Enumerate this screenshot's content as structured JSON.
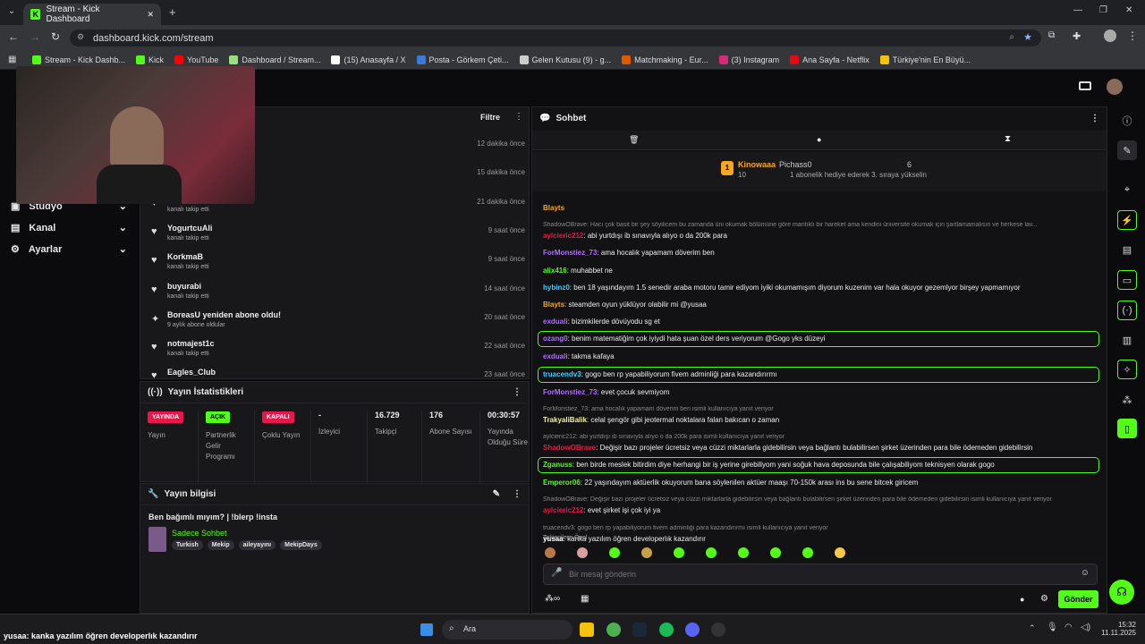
{
  "browser": {
    "tab_title": "Stream - Kick Dashboard",
    "url": "dashboard.kick.com/stream",
    "bookmarks": [
      {
        "label": "Stream - Kick Dashb...",
        "color": "#53fc18"
      },
      {
        "label": "Kick",
        "color": "#53fc18"
      },
      {
        "label": "YouTube",
        "color": "#ff0000"
      },
      {
        "label": "Dashboard / Stream...",
        "color": "#9adf7f"
      },
      {
        "label": "(15) Anasayfa / X",
        "color": "#ffffff"
      },
      {
        "label": "Posta - Görkem Çeti...",
        "color": "#3a7bd5"
      },
      {
        "label": "Gelen Kutusu (9) - g...",
        "color": "#cccccc"
      },
      {
        "label": "Matchmaking - Eur...",
        "color": "#e05a00"
      },
      {
        "label": "(3) Instagram",
        "color": "#d62976"
      },
      {
        "label": "Ana Sayfa - Netflix",
        "color": "#e50914"
      },
      {
        "label": "Türkiye'nin En Büyü...",
        "color": "#f4c20d"
      }
    ]
  },
  "sidebar": {
    "items": [
      {
        "label": "Stüdyo"
      },
      {
        "label": "Kanal"
      },
      {
        "label": "Ayarlar"
      }
    ]
  },
  "activity": {
    "filter_label": "Filtre",
    "items": [
      {
        "name": "",
        "sub": "",
        "time": "12 dakika önce"
      },
      {
        "name": "",
        "sub": "",
        "time": "15 dakika önce"
      },
      {
        "name": "",
        "sub": "kanalı takip etti",
        "time": "21 dakika önce"
      },
      {
        "name": "YogurtcuAli",
        "sub": "kanalı takip etti",
        "time": "9 saat önce"
      },
      {
        "name": "KorkmaB",
        "sub": "kanalı takip etti",
        "time": "9 saat önce"
      },
      {
        "name": "buyurabi",
        "sub": "kanalı takip etti",
        "time": "14 saat önce"
      },
      {
        "name": "BoreasU yeniden abone oldu!",
        "sub": "9 aylık abone oldular",
        "time": "20 saat önce"
      },
      {
        "name": "notmajest1c",
        "sub": "kanalı takip etti",
        "time": "22 saat önce"
      },
      {
        "name": "Eagles_Club",
        "sub": "",
        "time": "23 saat önce"
      }
    ]
  },
  "stats": {
    "title": "Yayın İstatistikleri",
    "items": [
      {
        "badge": "YAYINDA",
        "label": "Yayın",
        "badge_color": "#e6174b"
      },
      {
        "badge": "AÇIK",
        "label": "Partnerlik Gelir Programı",
        "badge_color": "#53fc18"
      },
      {
        "badge": "KAPALI",
        "label": "Çoklu Yayın",
        "badge_color": "#e6174b"
      },
      {
        "value": "-",
        "label": "İzleyici"
      },
      {
        "value": "16.729",
        "label": "Takipçi"
      },
      {
        "value": "176",
        "label": "Abone Sayısı"
      },
      {
        "value": "00:30:57",
        "label": "Yayında Olduğu Süre"
      }
    ]
  },
  "info": {
    "title": "Yayın bilgisi",
    "stream_title": "Ben bağımlı mıyım? | !blerp !insta",
    "category": "Sadece Sohbet",
    "tags": [
      "Turkish",
      "Mekip",
      "aileyayını",
      "MekipDays"
    ]
  },
  "chat": {
    "title": "Sohbet",
    "leader1": {
      "name": "Kinowaaa",
      "value": "10"
    },
    "leader2": {
      "name": "Pichass0",
      "value": "6",
      "sub": "1 abonelik hediye ederek 3. sıraya yükselin"
    },
    "messages": [
      {
        "user": "Blayts",
        "text": "",
        "color": "#f5a623",
        "hl": false
      },
      {
        "reply": "ShadowOBrave: Hacı çok basit bir şey söyilicem bu zamanda üni okumak bölümüne göre mantıklı bir hareket ama kendini üniversite okumak için şartlamamalısın ve herkese lav..."
      },
      {
        "user": "aylcieric212",
        "text": ": abi yurtdışı ib sınavıyla alıyo o da 200k para",
        "color": "#e6174b"
      },
      {
        "user": "ForMonstiez_73",
        "text": ": ama hocalık yapamam döverim ben",
        "color": "#b16cff"
      },
      {
        "user": "alix416",
        "text": ": muhabbet ne",
        "color": "#53fc18"
      },
      {
        "user": "hybinz0",
        "text": ": ben 18 yaşındayım 1.5 senedir araba motoru tamir ediyom iyiki okumamışım diyorum kuzenim var hala okuyor gezemlyor birşey yapmamıyor",
        "color": "#3ad1ff"
      },
      {
        "user": "Blayts",
        "text": ": steamden oyun yüklüyor olabilir mi @yusaa",
        "color": "#f5a623"
      },
      {
        "user": "exduali",
        "text": ": bizimkilerde dövüyodu sg et",
        "color": "#b16cff"
      },
      {
        "user": "ozang0",
        "text": ": benim matematiğim çok iyiydi hata şuan özel ders veriyorum @Gogo yks düzeyi",
        "color": "#b16cff",
        "hl": true
      },
      {
        "user": "exduali",
        "text": ": takma kafaya",
        "color": "#b16cff"
      },
      {
        "user": "truacendv3",
        "text": ": gogo ben rp yapabiliyorum fivem adminliği para kazandırırmı",
        "color": "#3ad1ff",
        "hl": true
      },
      {
        "user": "ForMonstiez_73",
        "text": ": evet çocuk sevmiyom",
        "color": "#b16cff"
      },
      {
        "reply": "ForMonstiez_73: ama hocalık yapamam döverim ben isimli kullanıcıya yanıt veriyor"
      },
      {
        "user": "TrakyaliBalik",
        "text": ": celal şengör gibi jeotermal noktalara falan bakıcan o zaman",
        "color": "#f5f5a0"
      },
      {
        "reply": "aylcieric212: abi yurtdışı ib sınavıyla alıyo o da 200k para isimli kullanıcıya yanıt veriyor"
      },
      {
        "user": "ShadowOBrave",
        "text": ": Değişir bazı projeler ücretsiz veya cüzzi miktarlarla gidebilirsin veya bağlantı bulabilirsen şirket üzerinden para bile ödemeden gidebilirsin",
        "color": "#e6174b"
      },
      {
        "user": "Zganuss",
        "text": ": ben birde meslek bitirdim diye herhangi bir iş yerine girebiliyom yani soğuk hava deposunda bile çalışabiliyom teknisyen olarak gogo",
        "color": "#53fc18",
        "hl": true
      },
      {
        "user": "Emperor06",
        "text": ": 22 yaşındayım aktüerlik okuyorum bana söylenilen aktüer maaşı 70-150k arası ins bu sene bitcek giricem",
        "color": "#53fc18"
      },
      {
        "reply": "ShadowOBrave: Değişir bazı projeler ücretsiz veya cüzzi miktarlarla gidebilirsin veya bağlantı bulabilirsen şirket üzerinden para bile ödemeden gidebilirsin isimli kullanıcıya yanıt veriyor"
      },
      {
        "user": "aylcieric212",
        "text": ": evet şirket işi çok iyi ya",
        "color": "#e6174b"
      },
      {
        "reply": "truacendv3: gogo ben rp yapabiliyorum fivem adminliği para kazandırırmı isimli kullanıcıya yanıt veriyor"
      },
      {
        "user": "yusaa",
        "text": ": kanka yazılım öğren developerlık kazandırır",
        "color": "#ffffff"
      }
    ],
    "emote_label": "Takipçilere Özel",
    "input_placeholder": "Bir mesaj gönderin",
    "send_label": "Gönder"
  },
  "overlay": {
    "user": "yusaa",
    "text": ": kanka yazılım öğren developerlık kazandırır"
  },
  "taskbar": {
    "search": "Ara",
    "time": "15:32",
    "date": "11.11.2025"
  }
}
